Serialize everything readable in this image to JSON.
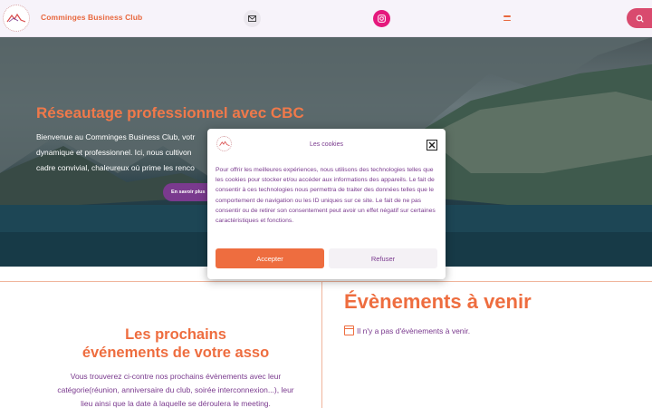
{
  "header": {
    "brand": "Comminges Business Club",
    "icons": {
      "logo": "cbc-logo",
      "mail": "mail-icon",
      "instagram": "instagram-icon",
      "menu": "menu-icon",
      "search": "search-icon"
    }
  },
  "hero": {
    "title": "Réseautage professionnel avec CBC",
    "text_lines": [
      "Bienvenue au Comminges Business Club, votr",
      "dynamique et professionnel. Ici, nous cultivon",
      "cadre convivial, chaleureux où prime les renco"
    ],
    "button_label": "En savoir plus"
  },
  "lower": {
    "left_title_lines": [
      "Les prochains",
      "événements de votre asso"
    ],
    "left_text_lines": [
      "Vous trouverez ci-contre nos prochains évènements avec leur",
      "catégorie(réunion, anniversaire du club, soirée interconnexion...), leur",
      "lieu ainsi que la date à laquelle se déroulera le meeting."
    ],
    "events_title": "Évènements à venir",
    "events_none": "Il n'y a pas d'évènements à venir."
  },
  "cookie_modal": {
    "title": "Les cookies",
    "body": "Pour offrir les meilleures expériences, nous utilisons des technologies telles que les cookies pour stocker et/ou accéder aux informations des appareils. Le fait de consentir à ces technologies nous permettra de traiter des données telles que le comportement de navigation ou les ID uniques sur ce site. Le fait de ne pas consentir ou de retirer son consentement peut avoir un effet négatif sur certaines caractéristiques et fonctions.",
    "accept_label": "Accepter",
    "refuse_label": "Refuser"
  },
  "colors": {
    "accent_orange": "#ee6d3f",
    "purple": "#7a3a8e",
    "instagram_pink": "#e5197d",
    "search_pink": "#d94a6e"
  }
}
